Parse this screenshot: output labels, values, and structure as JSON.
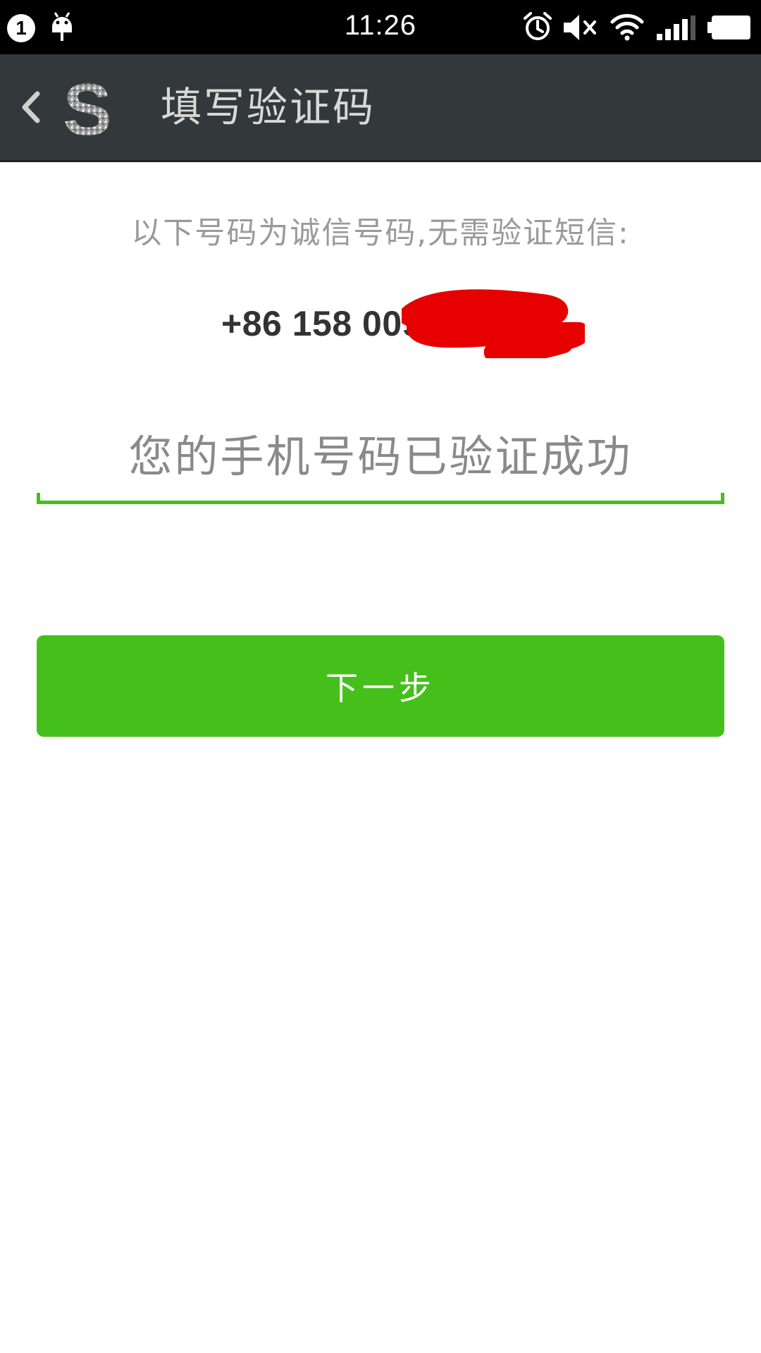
{
  "status_bar": {
    "notification_count": "1",
    "time": "11:26",
    "icons": [
      "notification-count-icon",
      "android-icon",
      "alarm-icon",
      "mute-icon",
      "wifi-icon",
      "signal-icon",
      "battery-icon"
    ]
  },
  "title_bar": {
    "back_icon": "chevron-left-icon",
    "avatar_letter": "S",
    "title": "填写验证码"
  },
  "content": {
    "notice": "以下号码为诚信号码,无需验证短信:",
    "phone_number": "+86 158 009",
    "code_field_value": "您的手机号码已验证成功",
    "next_button_label": "下一步"
  },
  "colors": {
    "accent_green": "#45c01a",
    "title_bar": "#33383b",
    "redaction_red": "#e60000"
  }
}
